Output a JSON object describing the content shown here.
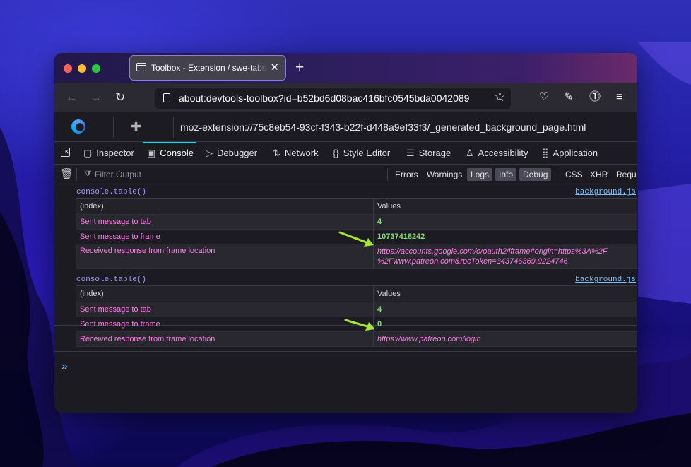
{
  "browser": {
    "tab_title": "Toolbox - Extension / swe-tabs-ext",
    "tab_close": "✕",
    "new_tab": "+",
    "url": "about:devtools-toolbox?id=b52bd6d08bac416bfc0545bda0042089",
    "icons": [
      "back-icon",
      "forward-icon",
      "reload-icon",
      "page-icon",
      "bookmark-star-icon",
      "pocket-icon",
      "tools-icon",
      "password-manager-icon",
      "menu-icon"
    ]
  },
  "toolbox": {
    "extension_url": "moz-extension://75c8eb54-93cf-f343-b22f-d448a9ef33f3/_generated_background_page.html"
  },
  "devtools_tabs": [
    {
      "label": "Inspector",
      "icon": "inspector-icon"
    },
    {
      "label": "Console",
      "icon": "console-icon"
    },
    {
      "label": "Debugger",
      "icon": "debugger-icon"
    },
    {
      "label": "Network",
      "icon": "network-icon"
    },
    {
      "label": "Style Editor",
      "icon": "style-editor-icon"
    },
    {
      "label": "Storage",
      "icon": "storage-icon"
    },
    {
      "label": "Accessibility",
      "icon": "accessibility-icon"
    },
    {
      "label": "Application",
      "icon": "application-icon"
    }
  ],
  "filter": {
    "placeholder": "Filter Output",
    "levels": [
      "Errors",
      "Warnings",
      "Logs",
      "Info",
      "Debug"
    ],
    "active_levels": [
      "Logs",
      "Info",
      "Debug"
    ],
    "types": [
      "CSS",
      "XHR",
      "Requests"
    ]
  },
  "console": {
    "messages": [
      {
        "call": "console.table()",
        "source": "background.js",
        "columns": [
          "(index)",
          "Values"
        ],
        "rows": [
          {
            "index": "Sent message to tab",
            "value": "4"
          },
          {
            "index": "Sent message to frame",
            "value": "10737418242"
          },
          {
            "index": "Received response from frame location",
            "value_line1": "https://accounts.google.com/o/oauth2/iframe#origin=https%3A%2F",
            "value_line2": "%2Fwww.patreon.com&rpcToken=343746369.9224746"
          }
        ]
      },
      {
        "call": "console.table()",
        "source": "background.js",
        "columns": [
          "(index)",
          "Values"
        ],
        "rows": [
          {
            "index": "Sent message to tab",
            "value": "4"
          },
          {
            "index": "Sent message to frame",
            "value": "0"
          },
          {
            "index": "Received response from frame location",
            "value": "https://www.patreon.com/login"
          }
        ]
      }
    ],
    "prompt": "»"
  },
  "colors": {
    "annotation_arrow": "#a3e635",
    "number": "#86de74",
    "string": "#ff7de9",
    "link": "#75bfff",
    "selected_tab_indicator": "#00ddff"
  }
}
